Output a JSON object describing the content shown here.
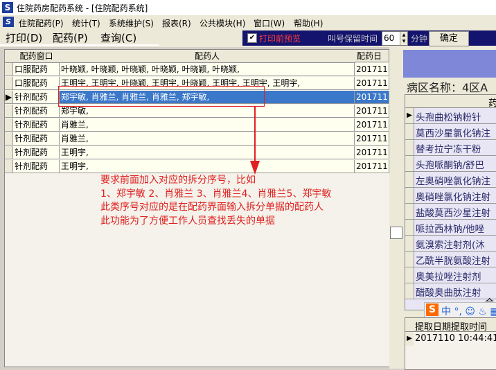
{
  "window": {
    "app_icon": "S",
    "title": "住院药房配药系统 - [住院配药系统]"
  },
  "menu": {
    "items": [
      "住院配药(P)",
      "统计(T)",
      "系统维护(S)",
      "报表(R)",
      "公共模块(H)",
      "窗口(W)",
      "帮助(H)"
    ]
  },
  "toolbar": {
    "tabs": [
      "打印(D)",
      "配药(P)",
      "查询(C)"
    ],
    "print_preview_label": "打印前预览",
    "print_preview_checked": true,
    "call_number_label": "叫号保留时间",
    "call_number_value": "60",
    "minutes_label": "分钟",
    "ok_label": "确定"
  },
  "grid": {
    "columns": [
      "配药窗口",
      "配药人",
      "配药日"
    ],
    "rows": [
      {
        "window": "口服配药",
        "person": "叶晓颖, 叶晓颖, 叶晓颖, 叶晓颖, 叶晓颖, 叶晓颖,",
        "date": "201711",
        "selected": false
      },
      {
        "window": "口服配药",
        "person": "王明宇, 王明宇, 叶晓颖, 王明宇, 叶晓颖, 王明宇, 王明宇, 王明宇,",
        "date": "201711",
        "selected": false
      },
      {
        "window": "针剂配药",
        "person": "郑宇敏, 肖雅兰, 肖雅兰, 肖雅兰, 郑宇敏,",
        "date": "201711",
        "selected": true
      },
      {
        "window": "针剂配药",
        "person": "郑宇敏,",
        "date": "201711",
        "selected": false
      },
      {
        "window": "针剂配药",
        "person": "肖雅兰,",
        "date": "201711",
        "selected": false
      },
      {
        "window": "针剂配药",
        "person": "肖雅兰,",
        "date": "201711",
        "selected": false
      },
      {
        "window": "针剂配药",
        "person": "王明宇,",
        "date": "201711",
        "selected": false
      },
      {
        "window": "针剂配药",
        "person": "王明宇,",
        "date": "201711",
        "selected": false
      }
    ]
  },
  "annotation": {
    "lines": [
      "要求前面加入对应的拆分序号，比如",
      "1、郑宇敏 2、肖雅兰 3、肖雅兰4、肖雅兰5、郑宇敏",
      "此类序号对应的是在配药界面输入拆分单据的配药人",
      "此功能为了方便工作人员查找丢失的单据"
    ]
  },
  "right_panel": {
    "ward_label": "病区名称：4区A",
    "drug_header": "药品",
    "drugs": [
      "头孢曲松钠粉针",
      "莫西沙星氯化钠注",
      "替考拉宁冻干粉",
      "头孢哌酮钠/舒巴",
      "左奥硝唑氯化钠注",
      "奥硝唑氯化钠注射",
      "盐酸莫西沙星注射",
      "哌拉西林钠/他唑",
      "氨溴索注射剂(沐",
      "乙酰半胱氨酸注射",
      "奥美拉唑注射剂",
      "醋酸奥曲肽注射"
    ],
    "sum_label": "合",
    "ime_logo": "S",
    "ime_text": "中 °, ☺ ♨ ▦",
    "bottom_header": "提取日期提取时间",
    "bottom_row": "2017110 10:44:41"
  },
  "colors": {
    "selection": "#3b78c9",
    "annotation": "#e02020",
    "banner": "#7f87d8"
  }
}
